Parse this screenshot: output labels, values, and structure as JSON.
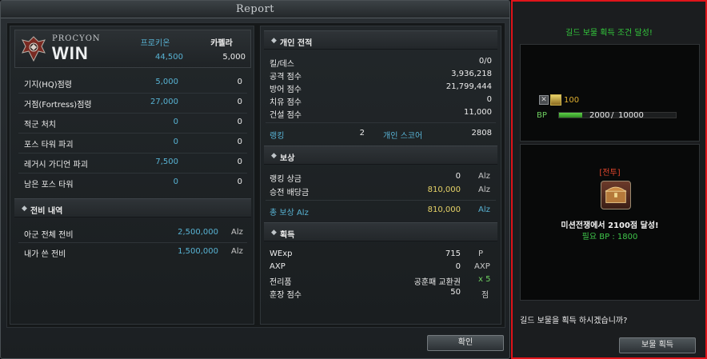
{
  "report": {
    "title": "Report",
    "logo": {
      "top": "PROCYON",
      "bottom": "WIN"
    },
    "factions": {
      "a": "프로키온",
      "b": "카펠라",
      "a_total": "44,500",
      "b_total": "5,000"
    },
    "rows": [
      {
        "label": "기지(HQ)점령",
        "a": "5,000",
        "b": "0"
      },
      {
        "label": "거점(Fortress)점령",
        "a": "27,000",
        "b": "0"
      },
      {
        "label": "적군 처치",
        "a": "0",
        "b": "0"
      },
      {
        "label": "포스 타워 파괴",
        "a": "0",
        "b": "0"
      },
      {
        "label": "레거시 가디언 파괴",
        "a": "7,500",
        "b": "0"
      },
      {
        "label": "남은 포스 타워",
        "a": "0",
        "b": "0"
      }
    ],
    "war_cost": {
      "header": "전비 내역",
      "rows": [
        {
          "label": "아군 전체 전비",
          "value": "2,500,000",
          "unit": "Alz"
        },
        {
          "label": "내가 쓴 전비",
          "value": "1,500,000",
          "unit": "Alz"
        }
      ]
    },
    "personal": {
      "header": "개인 전적",
      "rows": [
        {
          "label": "킬/데스",
          "value": "0/0"
        },
        {
          "label": "공격 점수",
          "value": "3,936,218"
        },
        {
          "label": "방어 점수",
          "value": "21,799,444"
        },
        {
          "label": "치유 점수",
          "value": "0"
        },
        {
          "label": "건설 점수",
          "value": "11,000"
        }
      ],
      "rank_label": "랭킹",
      "rank_value": "2",
      "score_label": "개인 스코어",
      "score_value": "2808"
    },
    "reward": {
      "header": "보상",
      "rows": [
        {
          "label": "랭킹 상금",
          "value": "0",
          "unit": "Alz"
        },
        {
          "label": "승전 배당금",
          "value": "810,000",
          "unit": "Alz"
        }
      ],
      "total_label": "총 보상 Alz",
      "total_value": "810,000",
      "total_unit": "Alz"
    },
    "acquired": {
      "header": "획득",
      "rows": [
        {
          "label": "WExp",
          "value": "715",
          "unit": "P"
        },
        {
          "label": "AXP",
          "value": "0",
          "unit": "AXP"
        },
        {
          "label": "전리품",
          "value": "공훈패 교환권",
          "unit": "x 5"
        },
        {
          "label": "훈장 점수",
          "value": "50",
          "unit": "점"
        }
      ]
    },
    "confirm_label": "확인"
  },
  "guild": {
    "title": "길드 보물 획득 조건 달성!",
    "count": "100",
    "bp_label": "BP",
    "bp_current": "2000",
    "bp_sep": "/",
    "bp_max": "10000",
    "bp_fill": 0.2,
    "mission_tag": "[전투]",
    "mission_text": "미션전쟁에서 2100점 달성!",
    "required_text": "필요 BP : 1800",
    "question": "길드 보물을 획득 하시겠습니까?",
    "acquire_label": "보물 획득"
  },
  "colors": {
    "blue": "#58b3d4",
    "yellow": "#e6d267",
    "green": "#6fd061",
    "guild_border": "#e0141a",
    "guild_title": "#33c93c",
    "mission_tag": "#e0452c"
  }
}
